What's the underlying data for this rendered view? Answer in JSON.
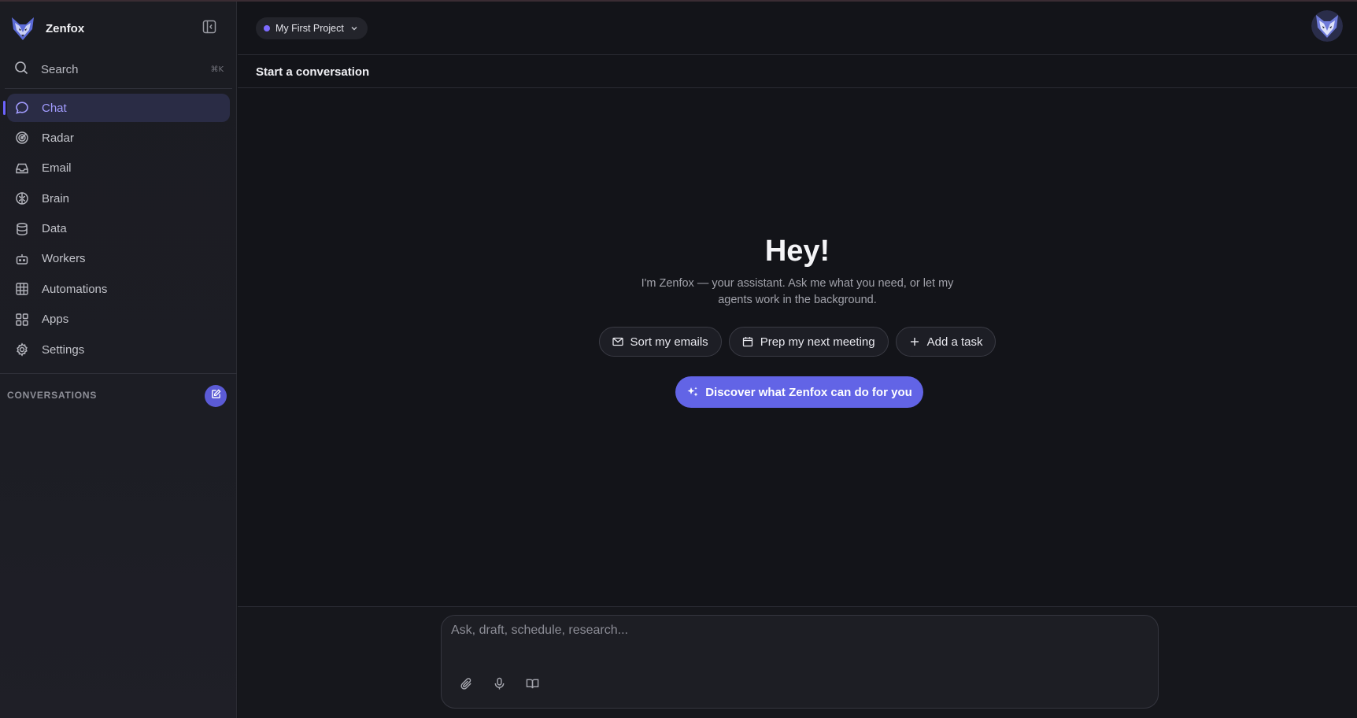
{
  "app": {
    "name": "Zenfox"
  },
  "colors": {
    "accent": "#6264e6",
    "active_text": "#a29cff",
    "background": "#131419",
    "sidebar": "#1c1d24"
  },
  "sidebar": {
    "search": {
      "label": "Search",
      "shortcut": "⌘K",
      "icon": "search-icon"
    },
    "items": [
      {
        "label": "Chat",
        "icon": "chat-icon",
        "active": true
      },
      {
        "label": "Radar",
        "icon": "radar-icon"
      },
      {
        "label": "Email",
        "icon": "inbox-icon"
      },
      {
        "label": "Brain",
        "icon": "brain-icon"
      },
      {
        "label": "Data",
        "icon": "database-icon"
      },
      {
        "label": "Workers",
        "icon": "bot-icon"
      },
      {
        "label": "Automations",
        "icon": "grid-icon"
      },
      {
        "label": "Apps",
        "icon": "apps-icon"
      },
      {
        "label": "Settings",
        "icon": "gear-icon"
      }
    ],
    "conversations_label": "CONVERSATIONS"
  },
  "topbar": {
    "project_name": "My First Project"
  },
  "subbar": {
    "title": "Start a conversation"
  },
  "hero": {
    "greeting": "Hey!",
    "intro": "I'm Zenfox — your assistant. Ask me what you need, or let my agents work in the background.",
    "chips": [
      {
        "label": "Sort my emails",
        "icon": "mail-icon"
      },
      {
        "label": "Prep my next meeting",
        "icon": "calendar-icon"
      },
      {
        "label": "Add a task",
        "icon": "plus-icon"
      }
    ],
    "discover_label": "Discover what Zenfox can do for you"
  },
  "composer": {
    "placeholder": "Ask, draft, schedule, research...",
    "value": ""
  }
}
